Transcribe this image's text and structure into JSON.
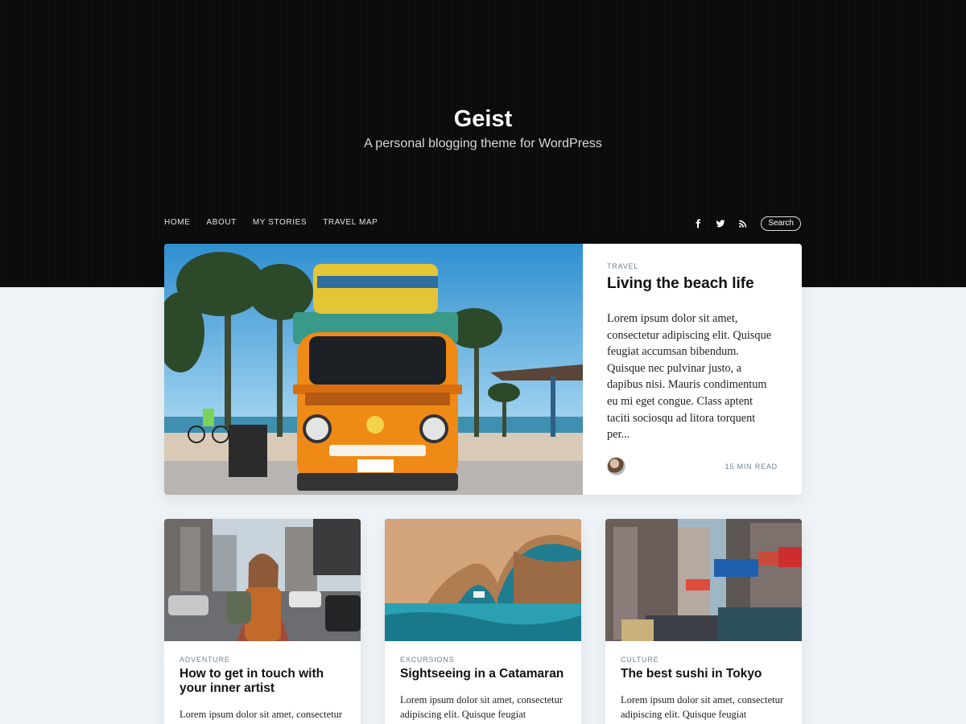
{
  "site": {
    "title": "Geist",
    "tagline": "A personal blogging theme for WordPress"
  },
  "nav": {
    "items": [
      "HOME",
      "ABOUT",
      "MY STORIES",
      "TRAVEL MAP"
    ]
  },
  "social": {
    "icons": [
      "facebook-icon",
      "twitter-icon",
      "rss-icon"
    ],
    "search_label": "Search"
  },
  "featured": {
    "category": "TRAVEL",
    "title": "Living the beach life",
    "excerpt": "Lorem ipsum dolor sit amet, consectetur adipiscing elit. Quisque feugiat accumsan bibendum. Quisque nec pulvinar justo, a dapibus nisi. Mauris condimentum eu mi eget congue. Class aptent taciti sociosqu ad litora torquent per...",
    "read_time": "15 MIN READ"
  },
  "cards": [
    {
      "category": "ADVENTURE",
      "title": "How to get in touch with your inner artist",
      "excerpt": "Lorem ipsum dolor sit amet, consectetur"
    },
    {
      "category": "EXCURSIONS",
      "title": "Sightseeing in a Catamaran",
      "excerpt": "Lorem ipsum dolor sit amet, consectetur adipiscing elit. Quisque feugiat"
    },
    {
      "category": "CULTURE",
      "title": "The best sushi in Tokyo",
      "excerpt": "Lorem ipsum dolor sit amet, consectetur adipiscing elit. Quisque feugiat"
    }
  ],
  "colors": {
    "hero_bg": "#0a0a0a",
    "page_bg": "#eef3f7",
    "category": "#6d8396"
  }
}
